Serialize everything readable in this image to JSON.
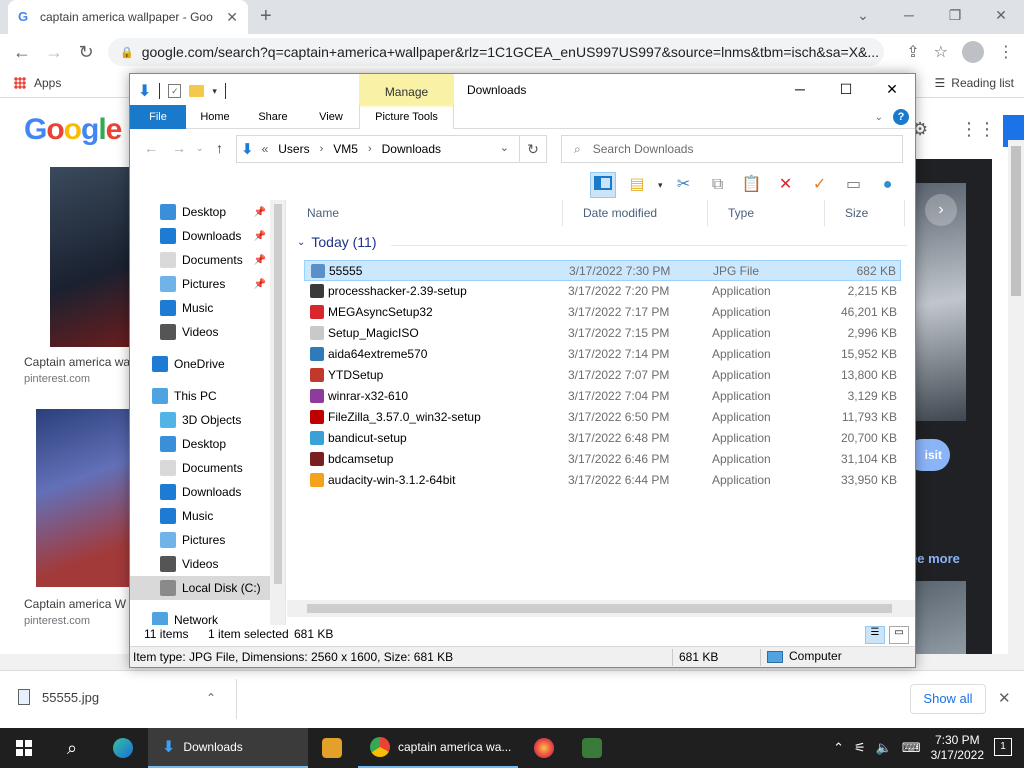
{
  "chrome": {
    "tab_title": "captain america wallpaper - Goo",
    "url": "google.com/search?q=captain+america+wallpaper&rlz=1C1GCEA_enUS997US997&source=lnms&tbm=isch&sa=X&...",
    "apps_label": "Apps",
    "reading_list": "Reading list"
  },
  "google": {
    "logo": [
      "G",
      "o",
      "o",
      "g",
      "l",
      "e"
    ],
    "results": [
      {
        "caption": "Captain america wa",
        "source": "pinterest.com"
      },
      {
        "caption": "Captain america W",
        "source": "pinterest.com"
      }
    ],
    "visit_label": "isit",
    "see_more": "ee more"
  },
  "explorer": {
    "title": "Downloads",
    "manage_tab": "Manage",
    "ribbon_tabs": [
      "File",
      "Home",
      "Share",
      "View",
      "Picture Tools"
    ],
    "breadcrumb": [
      "Users",
      "VM5",
      "Downloads"
    ],
    "search_placeholder": "Search Downloads",
    "nav": [
      {
        "label": "Desktop",
        "icon": "desktop-icon",
        "color": "#3b8ed8",
        "pinned": true,
        "indent": 1
      },
      {
        "label": "Downloads",
        "icon": "downloads-icon",
        "color": "#1e7bd4",
        "pinned": true,
        "indent": 1
      },
      {
        "label": "Documents",
        "icon": "documents-icon",
        "color": "#d9d9d9",
        "pinned": true,
        "indent": 1
      },
      {
        "label": "Pictures",
        "icon": "pictures-icon",
        "color": "#6fb3e8",
        "pinned": true,
        "indent": 1
      },
      {
        "label": "Music",
        "icon": "music-icon",
        "color": "#1e7bd4",
        "pinned": false,
        "indent": 1
      },
      {
        "label": "Videos",
        "icon": "videos-icon",
        "color": "#555555",
        "pinned": false,
        "indent": 1
      },
      {
        "label": "OneDrive",
        "icon": "onedrive-icon",
        "color": "#1e7bd4",
        "pinned": false,
        "indent": 0
      },
      {
        "label": "This PC",
        "icon": "this-pc-icon",
        "color": "#4fa3e0",
        "pinned": false,
        "indent": 0
      },
      {
        "label": "3D Objects",
        "icon": "3d-objects-icon",
        "color": "#52b3e6",
        "pinned": false,
        "indent": 1
      },
      {
        "label": "Desktop",
        "icon": "desktop-icon",
        "color": "#3b8ed8",
        "pinned": false,
        "indent": 1
      },
      {
        "label": "Documents",
        "icon": "documents-icon",
        "color": "#d9d9d9",
        "pinned": false,
        "indent": 1
      },
      {
        "label": "Downloads",
        "icon": "downloads-icon",
        "color": "#1e7bd4",
        "pinned": false,
        "indent": 1
      },
      {
        "label": "Music",
        "icon": "music-icon",
        "color": "#1e7bd4",
        "pinned": false,
        "indent": 1
      },
      {
        "label": "Pictures",
        "icon": "pictures-icon",
        "color": "#6fb3e8",
        "pinned": false,
        "indent": 1
      },
      {
        "label": "Videos",
        "icon": "videos-icon",
        "color": "#555555",
        "pinned": false,
        "indent": 1
      },
      {
        "label": "Local Disk (C:)",
        "icon": "local-disk-icon",
        "color": "#8a8a8a",
        "pinned": false,
        "indent": 1,
        "selected": true
      },
      {
        "label": "Network",
        "icon": "network-icon",
        "color": "#4fa3e0",
        "pinned": false,
        "indent": 0
      }
    ],
    "columns": [
      "Name",
      "Date modified",
      "Type",
      "Size"
    ],
    "group": "Today (11)",
    "files": [
      {
        "name": "55555",
        "date": "3/17/2022 7:30 PM",
        "type": "JPG File",
        "size": "682 KB",
        "icon": "jpg-icon",
        "color": "#5b8fc9",
        "selected": true
      },
      {
        "name": "processhacker-2.39-setup",
        "date": "3/17/2022 7:20 PM",
        "type": "Application",
        "size": "2,215 KB",
        "icon": "processhacker-icon",
        "color": "#3a3a3a"
      },
      {
        "name": "MEGAsyncSetup32",
        "date": "3/17/2022 7:17 PM",
        "type": "Application",
        "size": "46,201 KB",
        "icon": "mega-icon",
        "color": "#d9272e"
      },
      {
        "name": "Setup_MagicISO",
        "date": "3/17/2022 7:15 PM",
        "type": "Application",
        "size": "2,996 KB",
        "icon": "magiciso-icon",
        "color": "#c9c9c9"
      },
      {
        "name": "aida64extreme570",
        "date": "3/17/2022 7:14 PM",
        "type": "Application",
        "size": "15,952 KB",
        "icon": "aida64-icon",
        "color": "#2f7ab8"
      },
      {
        "name": "YTDSetup",
        "date": "3/17/2022 7:07 PM",
        "type": "Application",
        "size": "13,800 KB",
        "icon": "ytd-icon",
        "color": "#c0392b"
      },
      {
        "name": "winrar-x32-610",
        "date": "3/17/2022 7:04 PM",
        "type": "Application",
        "size": "3,129 KB",
        "icon": "winrar-icon",
        "color": "#8e3a9e"
      },
      {
        "name": "FileZilla_3.57.0_win32-setup",
        "date": "3/17/2022 6:50 PM",
        "type": "Application",
        "size": "11,793 KB",
        "icon": "filezilla-icon",
        "color": "#bf0000"
      },
      {
        "name": "bandicut-setup",
        "date": "3/17/2022 6:48 PM",
        "type": "Application",
        "size": "20,700 KB",
        "icon": "bandicut-icon",
        "color": "#3aa0d8"
      },
      {
        "name": "bdcamsetup",
        "date": "3/17/2022 6:46 PM",
        "type": "Application",
        "size": "31,104 KB",
        "icon": "bandicam-icon",
        "color": "#7a1f1f"
      },
      {
        "name": "audacity-win-3.1.2-64bit",
        "date": "3/17/2022 6:44 PM",
        "type": "Application",
        "size": "33,950 KB",
        "icon": "audacity-icon",
        "color": "#f2a31b"
      }
    ],
    "status": {
      "items": "11 items",
      "selected": "1 item selected",
      "size": "681 KB"
    },
    "info": {
      "details": "Item type: JPG File, Dimensions: 2560 x 1600, Size: 681 KB",
      "size": "681 KB",
      "location": "Computer"
    }
  },
  "download_shelf": {
    "file": "55555.jpg",
    "show_all": "Show all"
  },
  "taskbar": {
    "explorer_label": "Downloads",
    "chrome_label": "captain america wa...",
    "time": "7:30 PM",
    "date": "3/17/2022",
    "notifications": "1"
  }
}
